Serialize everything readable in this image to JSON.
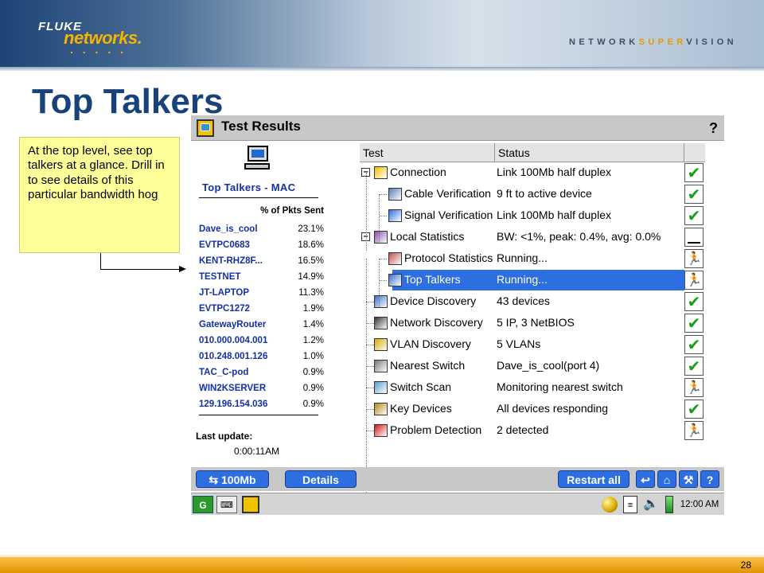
{
  "header": {
    "logo_fluke": "FLUKE",
    "logo_networks": "networks.",
    "logo_dots": ". . . . .",
    "tagline_a": "NETWORK",
    "tagline_b": "SUPER",
    "tagline_c": "VISION"
  },
  "slide_title": "Top Talkers",
  "callout": "At the top level, see top talkers at a glance.  Drill in to see details of this particular bandwidth hog",
  "window": {
    "title": "Test Results",
    "help_icon": "?"
  },
  "left_panel": {
    "title": "Top Talkers - MAC",
    "column_header": "% of Pkts Sent",
    "rows": [
      {
        "name": "Dave_is_cool",
        "pct": "23.1%"
      },
      {
        "name": "EVTPC0683",
        "pct": "18.6%"
      },
      {
        "name": "KENT-RHZ8F...",
        "pct": "16.5%"
      },
      {
        "name": "TESTNET",
        "pct": "14.9%"
      },
      {
        "name": "JT-LAPTOP",
        "pct": "11.3%"
      },
      {
        "name": "EVTPC1272",
        "pct": "1.9%"
      },
      {
        "name": "GatewayRouter",
        "pct": "1.4%"
      },
      {
        "name": "010.000.004.001",
        "pct": "1.2%"
      },
      {
        "name": "010.248.001.126",
        "pct": "1.0%"
      },
      {
        "name": "TAC_C-pod",
        "pct": "0.9%"
      },
      {
        "name": "WIN2KSERVER",
        "pct": "0.9%"
      },
      {
        "name": "129.196.154.036",
        "pct": "0.9%"
      }
    ],
    "last_update_label": "Last update:",
    "last_update_value": "0:00:11AM"
  },
  "table": {
    "col_test": "Test",
    "col_status": "Status",
    "rows": [
      {
        "name": "Connection",
        "status": "Link 100Mb half duplex",
        "state": "pass",
        "icon": "connection-icon"
      },
      {
        "name": "Cable Verification",
        "status": "9 ft to active device",
        "state": "pass",
        "icon": "cable-icon"
      },
      {
        "name": "Signal Verification",
        "status": "Link 100Mb half duplex",
        "state": "pass",
        "icon": "signal-icon"
      },
      {
        "name": "Local Statistics",
        "status": "BW: <1%, peak: 0.4%, avg: 0.0%",
        "state": "blank",
        "icon": "stats-icon"
      },
      {
        "name": "Protocol Statistics",
        "status": "Running...",
        "state": "running",
        "icon": "protocol-icon"
      },
      {
        "name": "Top Talkers",
        "status": "Running...",
        "state": "running",
        "icon": "computer-icon"
      },
      {
        "name": "Device Discovery",
        "status": "43 devices",
        "state": "pass",
        "icon": "computer-icon"
      },
      {
        "name": "Network Discovery",
        "status": "5 IP, 3 NetBIOS",
        "state": "pass",
        "icon": "network-icon"
      },
      {
        "name": "VLAN Discovery",
        "status": "5 VLANs",
        "state": "pass",
        "icon": "vlan-icon"
      },
      {
        "name": "Nearest Switch",
        "status": "Dave_is_cool(port 4)",
        "state": "pass",
        "icon": "switch-icon"
      },
      {
        "name": "Switch Scan",
        "status": "Monitoring nearest switch",
        "state": "running",
        "icon": "scan-icon"
      },
      {
        "name": "Key Devices",
        "status": "All devices responding",
        "state": "pass",
        "icon": "key-icon"
      },
      {
        "name": "Problem Detection",
        "status": "2 detected",
        "state": "running",
        "icon": "problem-icon"
      }
    ]
  },
  "buttons": {
    "speed": "100Mb",
    "details": "Details",
    "restart": "Restart all"
  },
  "taskbar": {
    "clock": "12:00 AM"
  },
  "footer": {
    "page": "28"
  }
}
